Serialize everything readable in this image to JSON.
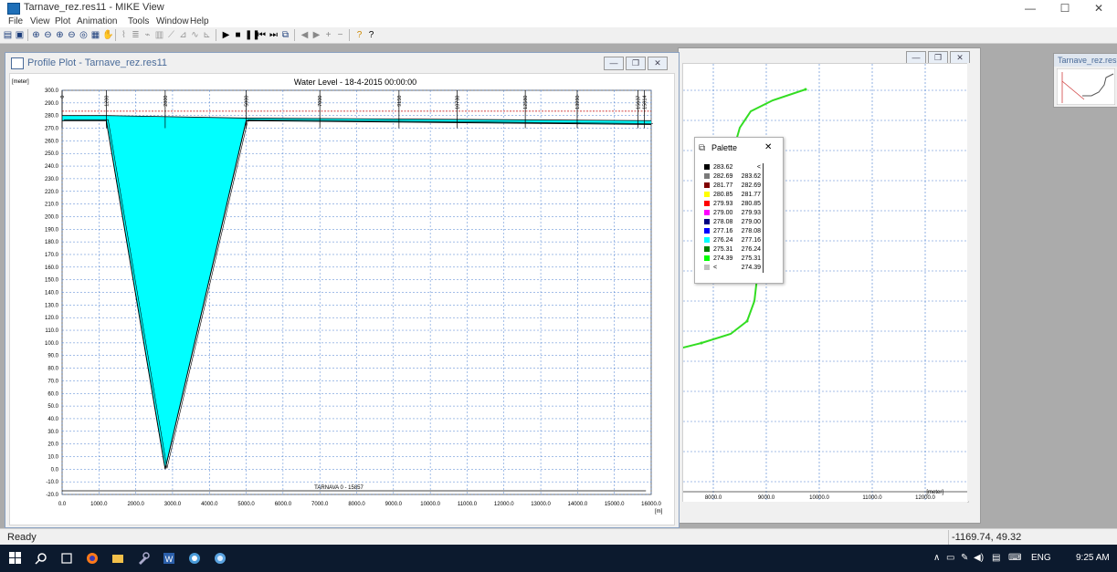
{
  "window": {
    "title": "Tarnave_rez.res11 - MIKE View",
    "controls": {
      "minimize": "—",
      "maximize": "☐",
      "close": "✕"
    }
  },
  "menu": [
    "File",
    "View",
    "Plot",
    "Animation",
    "Tools",
    "Window",
    "Help"
  ],
  "profile_window": {
    "title": "Profile Plot - Tarnave_rez.res11",
    "mdi_controls": {
      "minimize": "—",
      "restore": "❐",
      "close": "✕"
    }
  },
  "plan_window": {
    "x_ticks": [
      "8000.0",
      "9000.0",
      "10000.0",
      "11000.0",
      "12000.0"
    ],
    "x_unit": "[meter]"
  },
  "mini_window": {
    "title": "Tarnave_rez.res"
  },
  "palette": {
    "title": "Palette",
    "close": "✕",
    "rows": [
      {
        "color": "#000000",
        "a": "283.62",
        "b": "<"
      },
      {
        "color": "#7a7a7a",
        "a": "282.69",
        "b": "283.62"
      },
      {
        "color": "#800000",
        "a": "281.77",
        "b": "282.69"
      },
      {
        "color": "#ffff00",
        "a": "280.85",
        "b": "281.77"
      },
      {
        "color": "#ff0000",
        "a": "279.93",
        "b": "280.85"
      },
      {
        "color": "#ff00ff",
        "a": "279.00",
        "b": "279.93"
      },
      {
        "color": "#000080",
        "a": "278.08",
        "b": "279.00"
      },
      {
        "color": "#0000ff",
        "a": "277.16",
        "b": "278.08"
      },
      {
        "color": "#00ffff",
        "a": "276.24",
        "b": "277.16"
      },
      {
        "color": "#008000",
        "a": "275.31",
        "b": "276.24"
      },
      {
        "color": "#00ff00",
        "a": "274.39",
        "b": "275.31"
      },
      {
        "color": "#c0c0c0",
        "a": "<",
        "b": "274.39"
      }
    ]
  },
  "status": {
    "text": "Ready",
    "coords": "-1169.74, 49.32"
  },
  "taskbar": {
    "lang": "ENG",
    "time": "9:25 AM"
  },
  "chart_data": {
    "type": "area",
    "title": "Water Level - 18-4-2015 00:00:00",
    "ylabel": "[meter]",
    "xlabel": "[m]",
    "xlim": [
      0,
      16000
    ],
    "ylim": [
      -20,
      300
    ],
    "x_ticks": [
      0,
      1000,
      2000,
      3000,
      4000,
      5000,
      6000,
      7000,
      8000,
      9000,
      10000,
      11000,
      12000,
      13000,
      14000,
      15000,
      16000
    ],
    "y_ticks": [
      -20,
      -10,
      0,
      10,
      20,
      30,
      40,
      50,
      60,
      70,
      80,
      90,
      100,
      110,
      120,
      130,
      140,
      150,
      160,
      170,
      180,
      190,
      200,
      210,
      220,
      230,
      240,
      250,
      260,
      270,
      280,
      290,
      300
    ],
    "chainage_labels": [
      {
        "x": 0,
        "label": "0"
      },
      {
        "x": 1200,
        "label": "1200"
      },
      {
        "x": 2800,
        "label": "2800"
      },
      {
        "x": 5000,
        "label": "5000"
      },
      {
        "x": 7000,
        "label": "7000"
      },
      {
        "x": 9150,
        "label": "9150"
      },
      {
        "x": 10730,
        "label": "10730"
      },
      {
        "x": 12580,
        "label": "12580"
      },
      {
        "x": 13990,
        "label": "13990"
      },
      {
        "x": 15637,
        "label": "15637"
      },
      {
        "x": 15814,
        "label": "15814"
      }
    ],
    "branch_label": "TARNAVA  0 - 15857",
    "bed": {
      "x": [
        0,
        1200,
        2800,
        5000,
        16000
      ],
      "y": [
        276,
        276,
        0,
        276,
        273
      ]
    },
    "water_level": {
      "x": [
        0,
        1200,
        5000,
        16000
      ],
      "y": [
        280,
        280,
        278,
        276
      ]
    },
    "bank_level": {
      "x": [
        0,
        16000
      ],
      "y": [
        283.5,
        283.5
      ]
    },
    "fill_color": "#00ffff"
  }
}
